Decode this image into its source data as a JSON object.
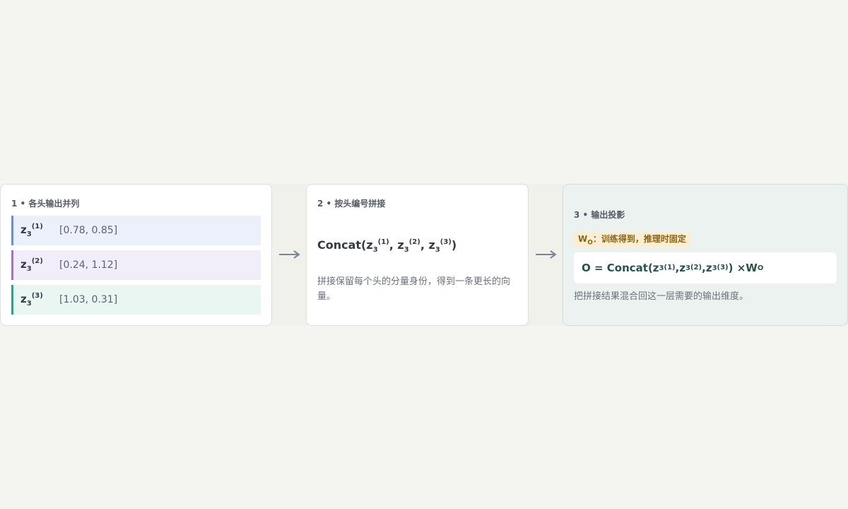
{
  "steps": [
    {
      "title": "1 • 各头输出并列",
      "heads": [
        {
          "symbol": "z",
          "sub": "3",
          "sup": "(1)",
          "vector": "[0.78, 0.85]",
          "accent": "#6f8fcf",
          "bg": "#ecf0fb"
        },
        {
          "symbol": "z",
          "sub": "3",
          "sup": "(2)",
          "vector": "[0.24, 1.12]",
          "accent": "#9a7bc0",
          "bg": "#f1eef9"
        },
        {
          "symbol": "z",
          "sub": "3",
          "sup": "(3)",
          "vector": "[1.03, 0.31]",
          "accent": "#3f9b86",
          "bg": "#eaf6f1"
        }
      ]
    },
    {
      "title": "2 • 按头编号拼接",
      "formula": {
        "fn": "Concat(",
        "terms": [
          {
            "symbol": "z",
            "sub": "3",
            "sup": "(1)"
          },
          {
            "symbol": "z",
            "sub": "3",
            "sup": "(2)"
          },
          {
            "symbol": "z",
            "sub": "3",
            "sup": "(3)"
          }
        ],
        "sep": ", ",
        "close": ")"
      },
      "note": "拼接保留每个头的分量身份，得到一条更长的向量。"
    },
    {
      "title": "3 • 输出投影",
      "badge": {
        "symbol": "W",
        "sub": "O",
        "text": "：训练得到，推理时固定"
      },
      "formula": {
        "lhs": "O = Concat(",
        "terms": [
          {
            "symbol": "z",
            "sub": "3",
            "sup": "(1)"
          },
          {
            "symbol": "z",
            "sub": "3",
            "sup": "(2)"
          },
          {
            "symbol": "z",
            "sub": "3",
            "sup": "(3)"
          }
        ],
        "sep": ", ",
        "close": ") × ",
        "w_symbol": "W",
        "w_sub": "O"
      },
      "note": "把拼接结果混合回这一层需要的输出维度。"
    }
  ],
  "arrow_icon": "right-arrow-icon",
  "colors": {
    "background": "#f4f5f1",
    "panel": "#ffffff",
    "panel_highlight": "#ebf2ef",
    "arrow": "#7b8694",
    "badge_bg": "#fbeed2",
    "output_text": "#245448"
  }
}
